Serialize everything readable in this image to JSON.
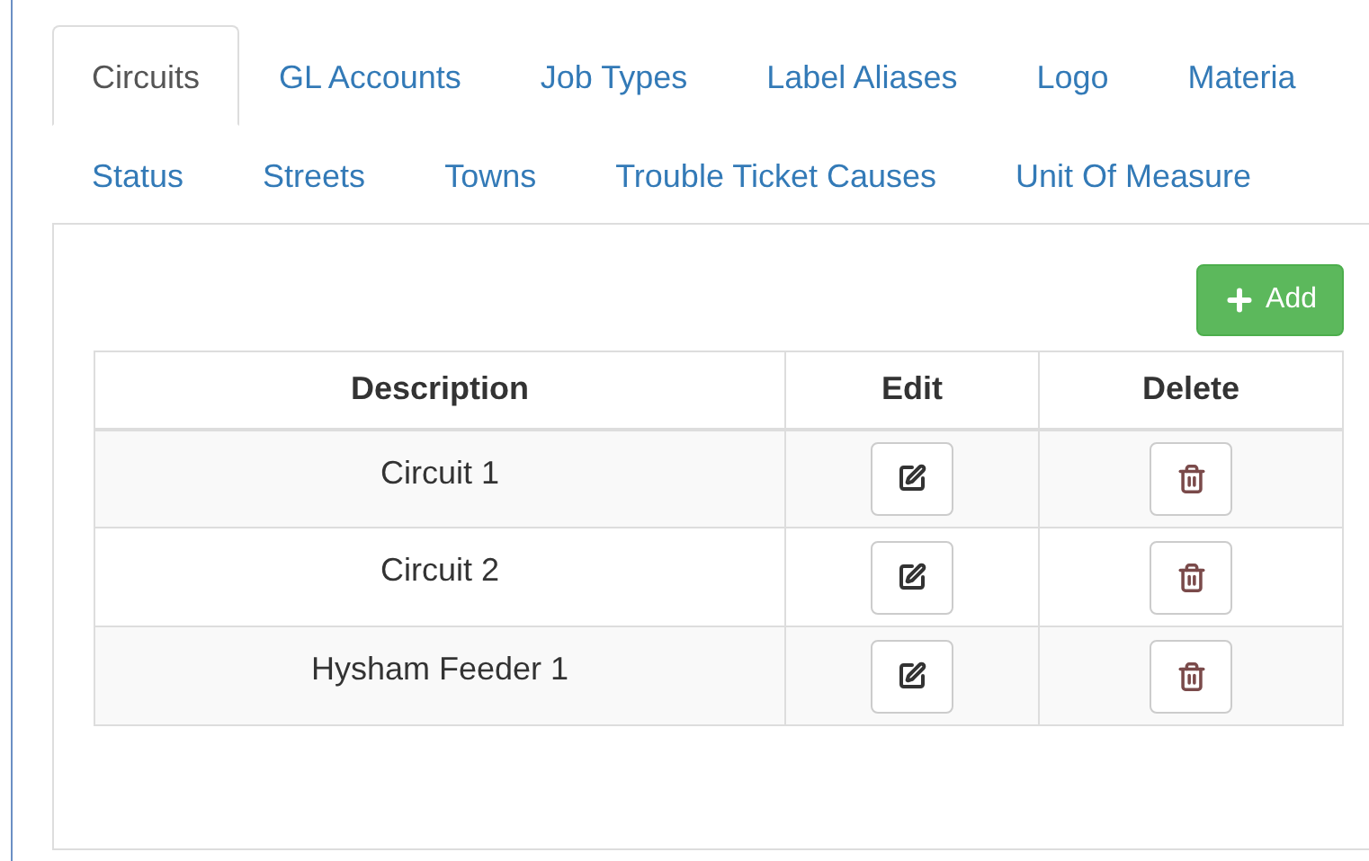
{
  "tabs": [
    {
      "label": "Circuits",
      "selected": true
    },
    {
      "label": "GL Accounts",
      "selected": false
    },
    {
      "label": "Job Types",
      "selected": false
    },
    {
      "label": "Label Aliases",
      "selected": false
    },
    {
      "label": "Logo",
      "selected": false
    },
    {
      "label": "Materia",
      "selected": false
    },
    {
      "label": "Status",
      "selected": false
    },
    {
      "label": "Streets",
      "selected": false
    },
    {
      "label": "Towns",
      "selected": false
    },
    {
      "label": "Trouble Ticket Causes",
      "selected": false
    },
    {
      "label": "Unit Of Measure",
      "selected": false
    }
  ],
  "add_button": {
    "label": "Add"
  },
  "table": {
    "columns": [
      "Description",
      "Edit",
      "Delete"
    ],
    "rows": [
      {
        "description": "Circuit 1"
      },
      {
        "description": "Circuit 2"
      },
      {
        "description": "Hysham Feeder 1"
      }
    ]
  }
}
